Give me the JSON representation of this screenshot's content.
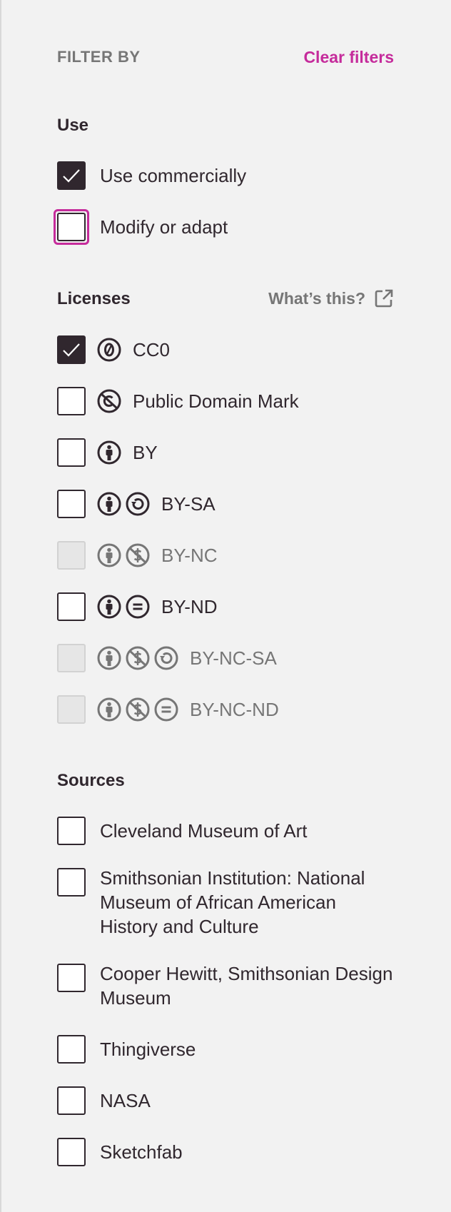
{
  "header": {
    "title": "FILTER BY",
    "clear_label": "Clear filters"
  },
  "use": {
    "title": "Use",
    "items": [
      {
        "label": "Use commercially",
        "checked": true
      },
      {
        "label": "Modify or adapt",
        "checked": false
      }
    ]
  },
  "licenses": {
    "title": "Licenses",
    "whats_this": "What’s this?",
    "items": [
      {
        "label": "CC0",
        "icons": [
          "zero-icon"
        ],
        "checked": true,
        "disabled": false
      },
      {
        "label": "Public Domain Mark",
        "icons": [
          "public-domain-icon"
        ],
        "checked": false,
        "disabled": false
      },
      {
        "label": "BY",
        "icons": [
          "attribution-icon"
        ],
        "checked": false,
        "disabled": false
      },
      {
        "label": "BY-SA",
        "icons": [
          "attribution-icon",
          "share-alike-icon"
        ],
        "checked": false,
        "disabled": false
      },
      {
        "label": "BY-NC",
        "icons": [
          "attribution-icon",
          "non-commercial-icon"
        ],
        "checked": false,
        "disabled": true
      },
      {
        "label": "BY-ND",
        "icons": [
          "attribution-icon",
          "no-derivatives-icon"
        ],
        "checked": false,
        "disabled": false
      },
      {
        "label": "BY-NC-SA",
        "icons": [
          "attribution-icon",
          "non-commercial-icon",
          "share-alike-icon"
        ],
        "checked": false,
        "disabled": true
      },
      {
        "label": "BY-NC-ND",
        "icons": [
          "attribution-icon",
          "non-commercial-icon",
          "no-derivatives-icon"
        ],
        "checked": false,
        "disabled": true
      }
    ]
  },
  "sources": {
    "title": "Sources",
    "items": [
      {
        "label": "Cleveland Museum of Art",
        "checked": false
      },
      {
        "label": "Smithsonian Institution: National Museum of African American History and Culture",
        "checked": false
      },
      {
        "label": "Cooper Hewitt, Smithsonian Design Museum",
        "checked": false
      },
      {
        "label": "Thingiverse",
        "checked": false
      },
      {
        "label": "NASA",
        "checked": false
      },
      {
        "label": "Sketchfab",
        "checked": false
      }
    ]
  },
  "colors": {
    "accent": "#c52b9b",
    "text": "#30272e",
    "muted": "#767676",
    "background": "#f2f2f2"
  }
}
